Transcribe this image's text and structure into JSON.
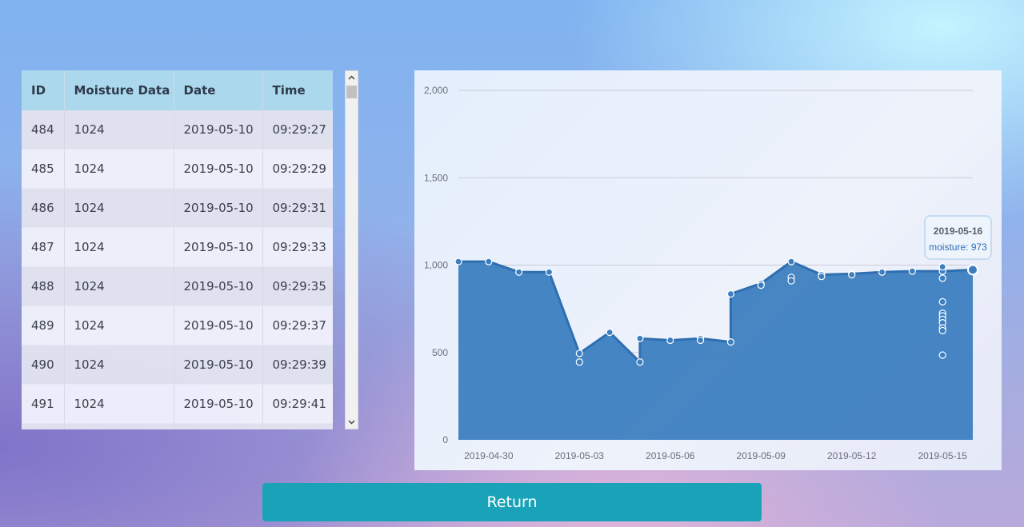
{
  "table": {
    "headers": [
      "ID",
      "Moisture Data",
      "Date",
      "Time"
    ],
    "rows": [
      [
        "484",
        "1024",
        "2019-05-10",
        "09:29:27"
      ],
      [
        "485",
        "1024",
        "2019-05-10",
        "09:29:29"
      ],
      [
        "486",
        "1024",
        "2019-05-10",
        "09:29:31"
      ],
      [
        "487",
        "1024",
        "2019-05-10",
        "09:29:33"
      ],
      [
        "488",
        "1024",
        "2019-05-10",
        "09:29:35"
      ],
      [
        "489",
        "1024",
        "2019-05-10",
        "09:29:37"
      ],
      [
        "490",
        "1024",
        "2019-05-10",
        "09:29:39"
      ],
      [
        "491",
        "1024",
        "2019-05-10",
        "09:29:41"
      ],
      [
        "",
        "",
        "",
        ""
      ]
    ]
  },
  "scrollbar": {
    "up_icon": "chevron-up-icon",
    "down_icon": "chevron-down-icon"
  },
  "chart_data": {
    "type": "area",
    "x_tick_labels": [
      "2019-04-30",
      "2019-05-03",
      "2019-05-06",
      "2019-05-09",
      "2019-05-12",
      "2019-05-15"
    ],
    "y_tick_labels": [
      "0",
      "500",
      "1,000",
      "1,500",
      "2,000"
    ],
    "ylim": [
      0,
      2000
    ],
    "xlim": [
      "2019-04-29",
      "2019-05-16"
    ],
    "series_color": "#3d7ec0",
    "line_points": [
      [
        "2019-04-29",
        1020
      ],
      [
        "2019-04-30",
        1020
      ],
      [
        "2019-05-01",
        960
      ],
      [
        "2019-05-02",
        960
      ],
      [
        "2019-05-03",
        495
      ],
      [
        "2019-05-04",
        615
      ],
      [
        "2019-05-05",
        445
      ],
      [
        "2019-05-05",
        580
      ],
      [
        "2019-05-06",
        570
      ],
      [
        "2019-05-07",
        580
      ],
      [
        "2019-05-08",
        560
      ],
      [
        "2019-05-08",
        835
      ],
      [
        "2019-05-09",
        895
      ],
      [
        "2019-05-10",
        1020
      ],
      [
        "2019-05-11",
        945
      ],
      [
        "2019-05-12",
        950
      ],
      [
        "2019-05-13",
        960
      ],
      [
        "2019-05-14",
        965
      ],
      [
        "2019-05-15",
        965
      ],
      [
        "2019-05-16",
        973
      ]
    ],
    "extra_points": [
      [
        "2019-05-03",
        445
      ],
      [
        "2019-05-07",
        570
      ],
      [
        "2019-05-09",
        885
      ],
      [
        "2019-05-10",
        930
      ],
      [
        "2019-05-10",
        910
      ],
      [
        "2019-05-11",
        935
      ],
      [
        "2019-05-12",
        945
      ],
      [
        "2019-05-15",
        990
      ],
      [
        "2019-05-15",
        925
      ],
      [
        "2019-05-15",
        790
      ],
      [
        "2019-05-15",
        725
      ],
      [
        "2019-05-15",
        710
      ],
      [
        "2019-05-15",
        690
      ],
      [
        "2019-05-15",
        670
      ],
      [
        "2019-05-15",
        640
      ],
      [
        "2019-05-15",
        625
      ],
      [
        "2019-05-15",
        485
      ]
    ],
    "tooltip": {
      "date": "2019-05-16",
      "label": "moisture: 973"
    }
  },
  "return_button": {
    "label": "Return"
  }
}
